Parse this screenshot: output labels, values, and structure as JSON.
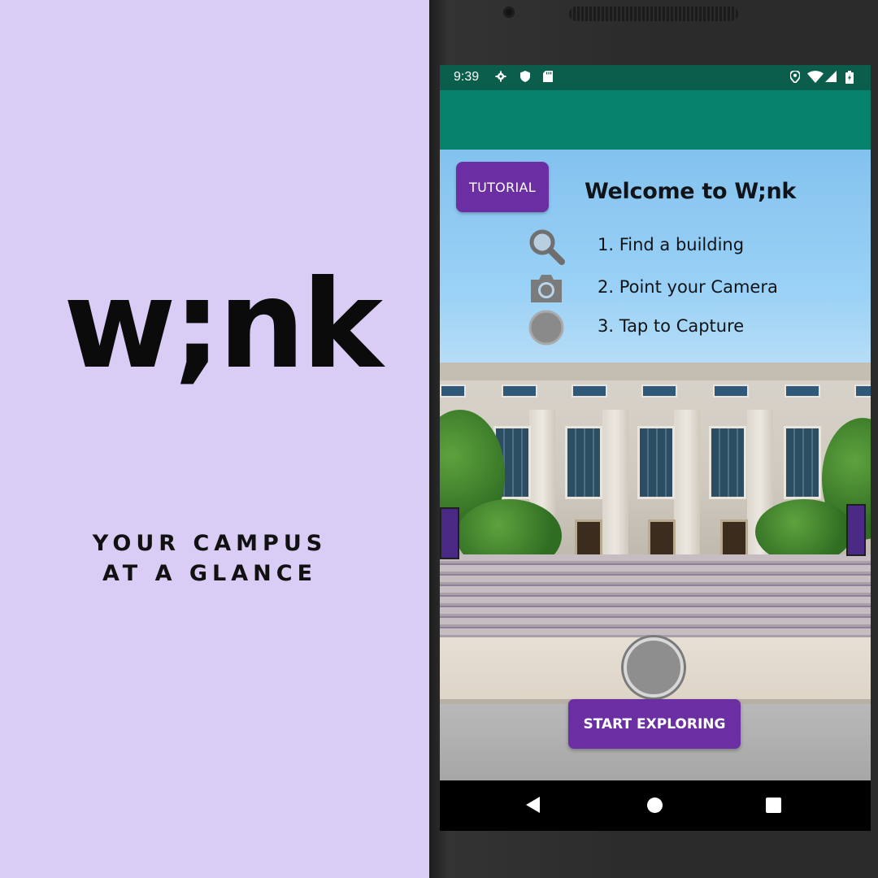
{
  "promo": {
    "logo": "w;nk",
    "tagline_line1": "YOUR CAMPUS",
    "tagline_line2": "AT A GLANCE"
  },
  "status_bar": {
    "time": "9:39",
    "left_icons": [
      "gear-icon",
      "shield-icon",
      "sd-card-icon"
    ],
    "right_icons": [
      "location-icon",
      "wifi-icon",
      "signal-icon",
      "battery-icon"
    ]
  },
  "colors": {
    "status_bar": "#0b5e4c",
    "app_bar": "#06826d",
    "button_purple": "#6b2fa3",
    "background_lavender": "#d9ccf5"
  },
  "overlay": {
    "tutorial_label": "TUTORIAL",
    "welcome_title": "Welcome to W;nk",
    "steps": [
      {
        "icon": "search-icon",
        "text": "1. Find a building"
      },
      {
        "icon": "camera-icon",
        "text": "2. Point your Camera"
      },
      {
        "icon": "capture-circle-icon",
        "text": "3. Tap to Capture"
      }
    ]
  },
  "actions": {
    "start_exploring_label": "START EXPLORING"
  }
}
